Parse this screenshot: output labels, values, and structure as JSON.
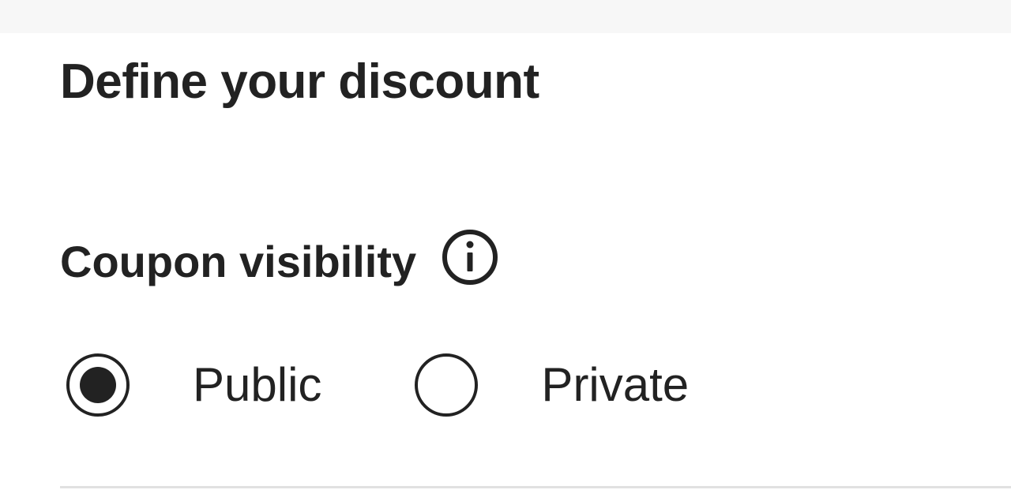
{
  "form": {
    "title": "Define your discount",
    "visibility": {
      "label": "Coupon visibility",
      "info_icon": "info-circle-icon",
      "selected": "Public",
      "options": [
        {
          "label": "Public",
          "checked": true
        },
        {
          "label": "Private",
          "checked": false
        }
      ]
    }
  },
  "colors": {
    "text": "#222222",
    "background": "#ffffff",
    "top_strip": "#f7f7f7",
    "divider": "#e1e1e1"
  }
}
